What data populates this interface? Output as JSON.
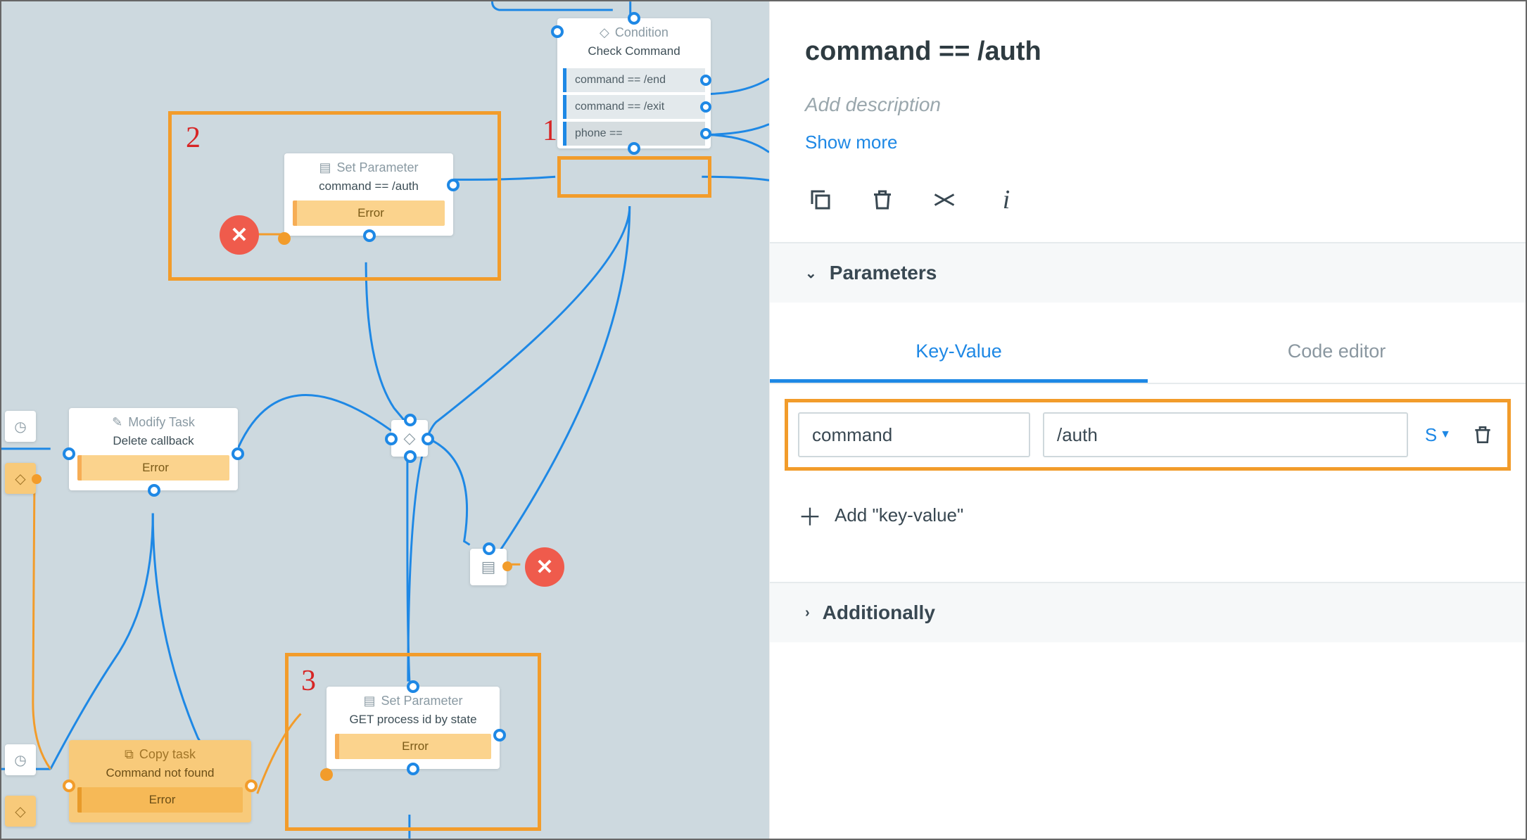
{
  "canvas": {
    "condition": {
      "type": "Condition",
      "title": "Check Command",
      "rows": [
        "command == /end",
        "command == /exit",
        "phone =="
      ]
    },
    "setparam1": {
      "type": "Set Parameter",
      "title": "command == /auth",
      "error": "Error"
    },
    "modify": {
      "type": "Modify Task",
      "title": "Delete callback",
      "error": "Error"
    },
    "setparam2": {
      "type": "Set Parameter",
      "title": "GET process id by state",
      "error": "Error"
    },
    "copy": {
      "type": "Copy task",
      "title": "Command not found",
      "error": "Error"
    },
    "annotations": {
      "n1": "1",
      "n2": "2",
      "n3": "3"
    }
  },
  "panel": {
    "title": "command == /auth",
    "desc_placeholder": "Add description",
    "show_more": "Show more",
    "sections": {
      "params": "Parameters",
      "additionally": "Additionally"
    },
    "tabs": {
      "kv": "Key-Value",
      "code": "Code editor"
    },
    "kv": {
      "key": "command",
      "value": "/auth",
      "type": "S"
    },
    "add_kv": "Add \"key-value\""
  }
}
